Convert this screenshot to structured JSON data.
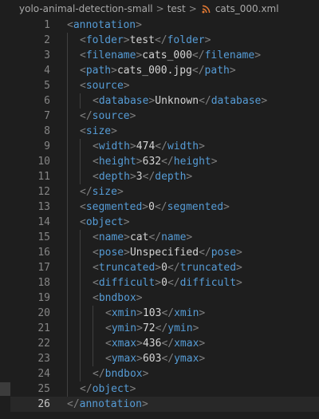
{
  "breadcrumb": {
    "segments": [
      "yolo-animal-detection-small",
      "test",
      "cats_000.xml"
    ],
    "separator": ">",
    "file_icon": "rss-icon",
    "file_icon_color": "#e37933"
  },
  "editor": {
    "active_line": 26,
    "lines": [
      {
        "n": "1",
        "indent": 0,
        "tag": "annotation",
        "kind": "open"
      },
      {
        "n": "2",
        "indent": 1,
        "tag": "folder",
        "kind": "leaf",
        "value": "test"
      },
      {
        "n": "3",
        "indent": 1,
        "tag": "filename",
        "kind": "leaf",
        "value": "cats_000"
      },
      {
        "n": "4",
        "indent": 1,
        "tag": "path",
        "kind": "leaf",
        "value": "cats_000.jpg"
      },
      {
        "n": "5",
        "indent": 1,
        "tag": "source",
        "kind": "open"
      },
      {
        "n": "6",
        "indent": 2,
        "tag": "database",
        "kind": "leaf",
        "value": "Unknown"
      },
      {
        "n": "7",
        "indent": 1,
        "tag": "source",
        "kind": "close"
      },
      {
        "n": "8",
        "indent": 1,
        "tag": "size",
        "kind": "open"
      },
      {
        "n": "9",
        "indent": 2,
        "tag": "width",
        "kind": "leaf",
        "value": "474"
      },
      {
        "n": "10",
        "indent": 2,
        "tag": "height",
        "kind": "leaf",
        "value": "632"
      },
      {
        "n": "11",
        "indent": 2,
        "tag": "depth",
        "kind": "leaf",
        "value": "3"
      },
      {
        "n": "12",
        "indent": 1,
        "tag": "size",
        "kind": "close"
      },
      {
        "n": "13",
        "indent": 1,
        "tag": "segmented",
        "kind": "leaf",
        "value": "0"
      },
      {
        "n": "14",
        "indent": 1,
        "tag": "object",
        "kind": "open"
      },
      {
        "n": "15",
        "indent": 2,
        "tag": "name",
        "kind": "leaf",
        "value": "cat"
      },
      {
        "n": "16",
        "indent": 2,
        "tag": "pose",
        "kind": "leaf",
        "value": "Unspecified"
      },
      {
        "n": "17",
        "indent": 2,
        "tag": "truncated",
        "kind": "leaf",
        "value": "0"
      },
      {
        "n": "18",
        "indent": 2,
        "tag": "difficult",
        "kind": "leaf",
        "value": "0"
      },
      {
        "n": "19",
        "indent": 2,
        "tag": "bndbox",
        "kind": "open"
      },
      {
        "n": "20",
        "indent": 3,
        "tag": "xmin",
        "kind": "leaf",
        "value": "103"
      },
      {
        "n": "21",
        "indent": 3,
        "tag": "ymin",
        "kind": "leaf",
        "value": "72"
      },
      {
        "n": "22",
        "indent": 3,
        "tag": "xmax",
        "kind": "leaf",
        "value": "436"
      },
      {
        "n": "23",
        "indent": 3,
        "tag": "ymax",
        "kind": "leaf",
        "value": "603"
      },
      {
        "n": "24",
        "indent": 2,
        "tag": "bndbox",
        "kind": "close"
      },
      {
        "n": "25",
        "indent": 1,
        "tag": "object",
        "kind": "close"
      },
      {
        "n": "26",
        "indent": 0,
        "tag": "annotation",
        "kind": "close"
      }
    ]
  },
  "colors": {
    "background": "#1e1e1e",
    "tag": "#569cd6",
    "punctuation": "#808080",
    "text": "#d4d4d4",
    "line_number": "#858585",
    "line_number_active": "#c6c6c6"
  }
}
